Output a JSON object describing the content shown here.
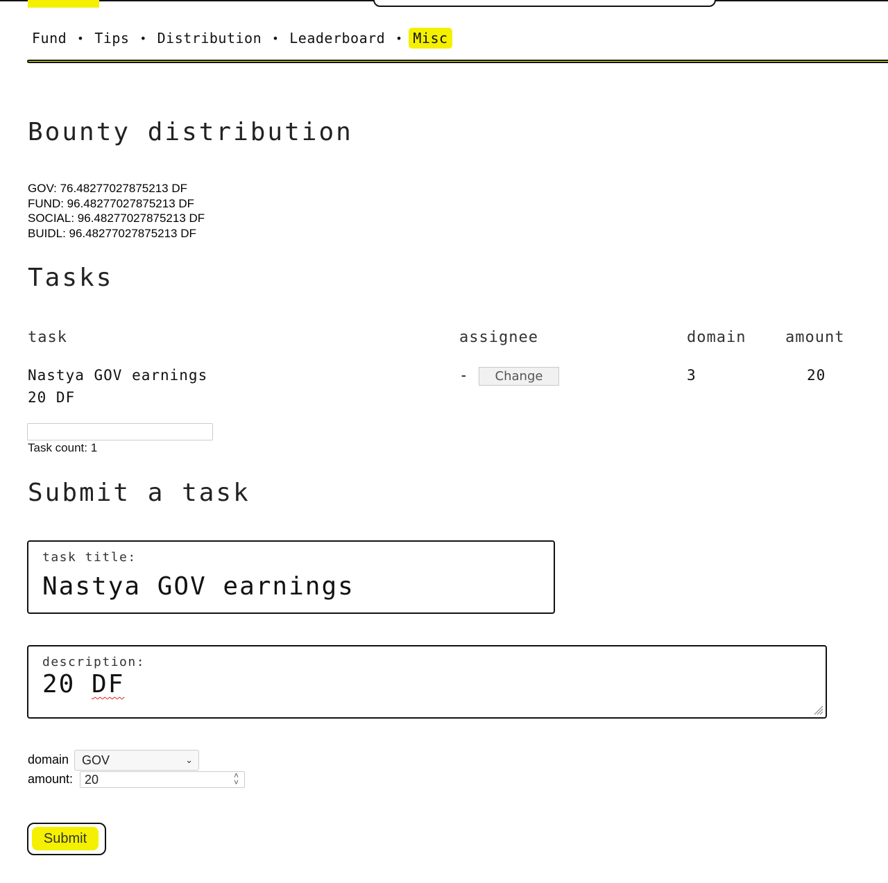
{
  "colors": {
    "accent": "#f4f000",
    "ink": "#111111"
  },
  "nav": {
    "items": [
      {
        "label": "Fund"
      },
      {
        "label": "Tips"
      },
      {
        "label": "Distribution"
      },
      {
        "label": "Leaderboard"
      },
      {
        "label": "Misc",
        "active": true
      }
    ],
    "separator": "•"
  },
  "bounty": {
    "title": "Bounty distribution",
    "lines": [
      "GOV: 76.48277027875213 DF",
      "FUND: 96.48277027875213 DF",
      "SOCIAL: 96.48277027875213 DF",
      "BUIDL: 96.48277027875213 DF"
    ]
  },
  "tasks": {
    "title": "Tasks",
    "columns": [
      "task",
      "assignee",
      "domain",
      "amount"
    ],
    "rows": [
      {
        "task_title": "Nastya GOV earnings",
        "task_description": "20 DF",
        "assignee": "-",
        "change_label": "Change",
        "domain": "3",
        "amount": "20"
      }
    ],
    "filter_value": "",
    "count_text": "Task count: 1"
  },
  "submit": {
    "title": "Submit a task",
    "task_title_label": "task title:",
    "task_title_value": "Nastya GOV earnings",
    "description_label": "description:",
    "description_value_num": "20",
    "description_value_unit": "DF",
    "domain_label": "domain",
    "domain_value": "GOV",
    "amount_label": "amount:",
    "amount_value": "20",
    "button_label": "Submit"
  },
  "icons": {
    "select_arrow": "chevron-down-icon",
    "number_spinner": "spinner-icon",
    "resize": "resize-grip-icon"
  }
}
